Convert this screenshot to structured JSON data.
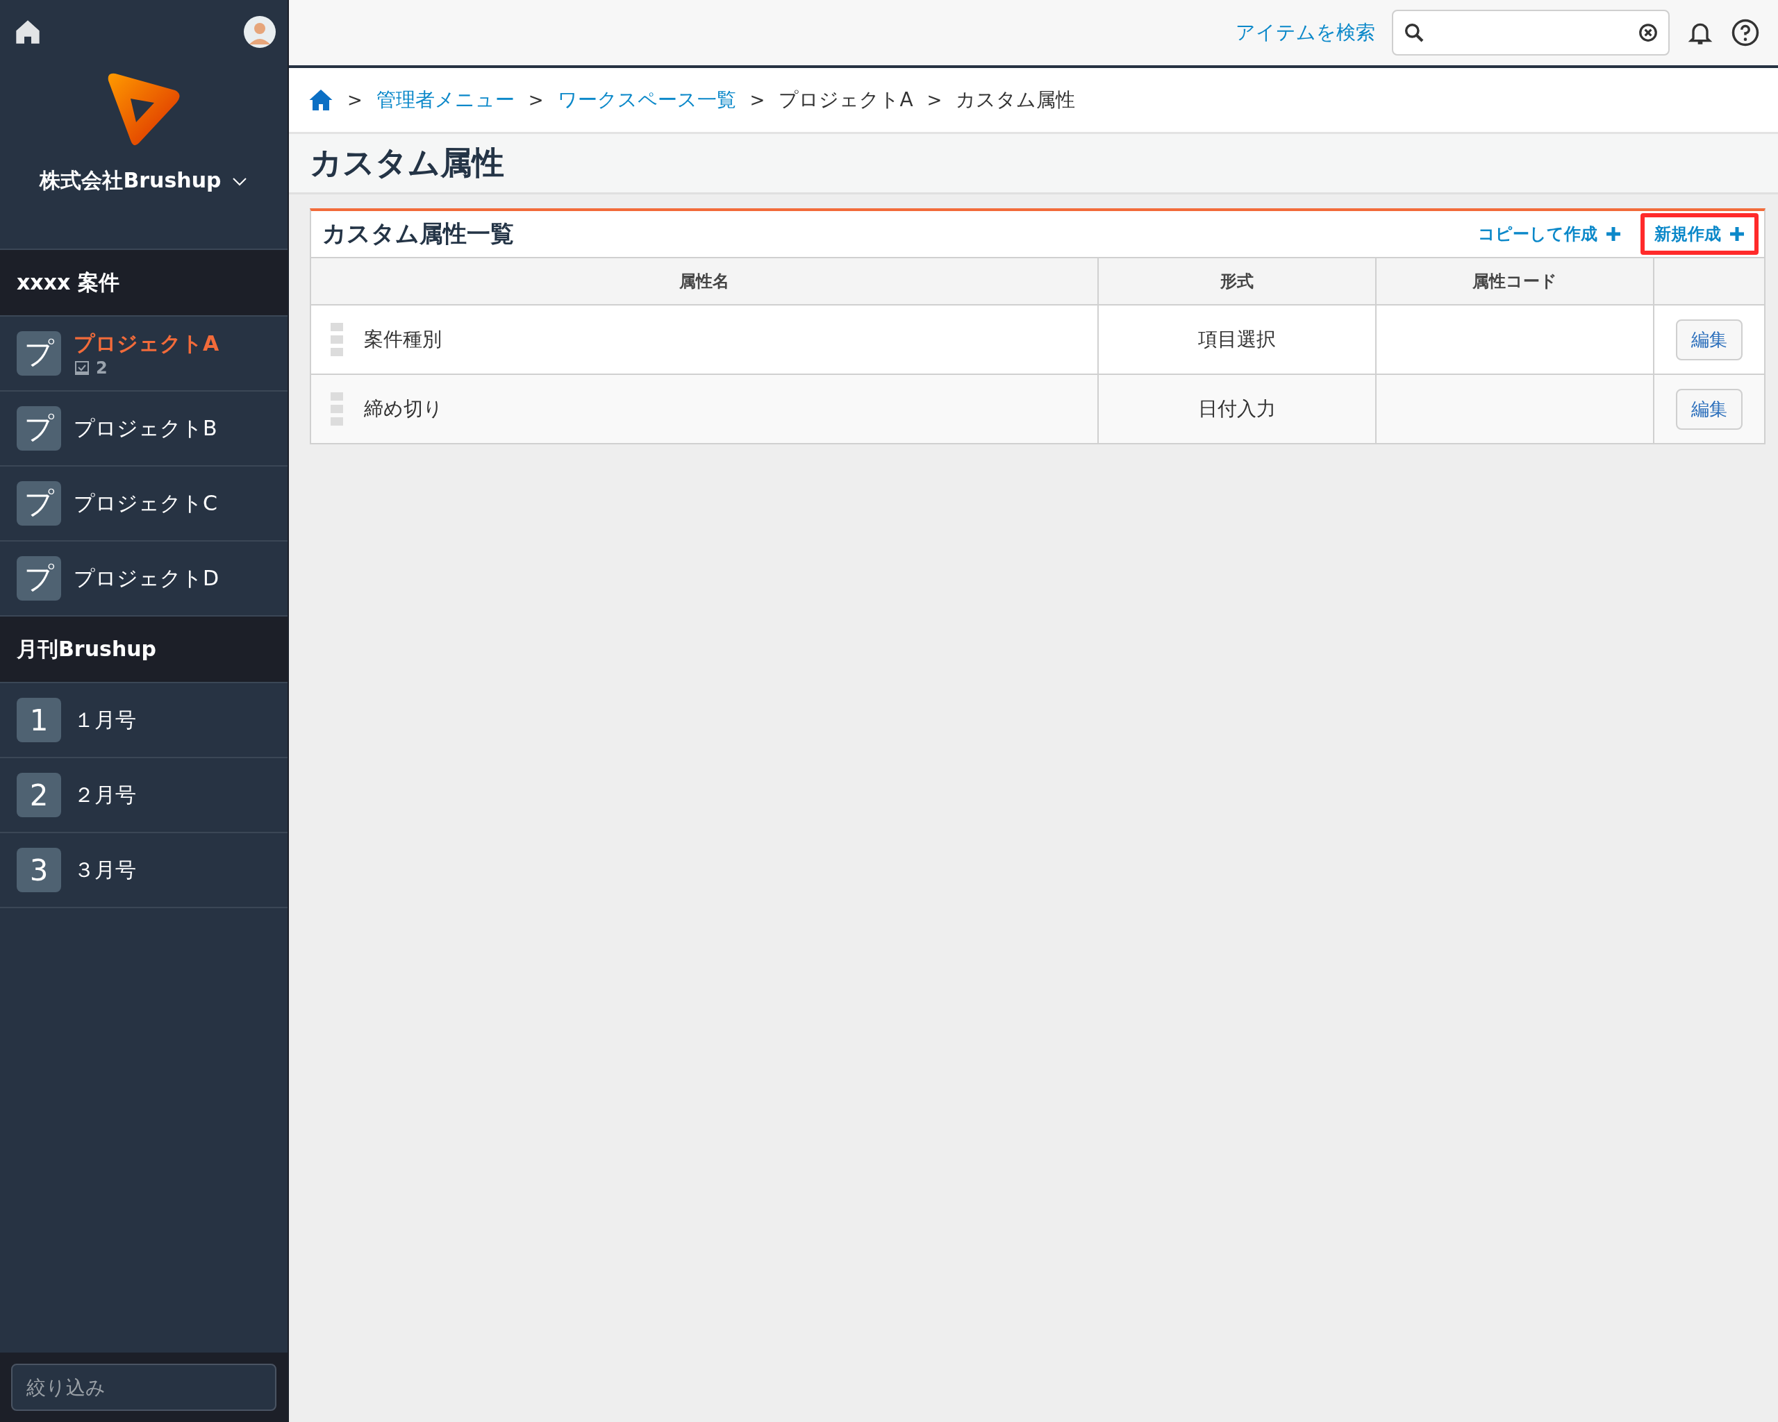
{
  "sidebar": {
    "company": "株式会社Brushup",
    "groups": [
      {
        "title": "xxxx 案件",
        "items": [
          {
            "icon_char": "プ",
            "label": "プロジェクトA",
            "selected": true,
            "task_count": "2"
          },
          {
            "icon_char": "プ",
            "label": "プロジェクトB",
            "selected": false
          },
          {
            "icon_char": "プ",
            "label": "プロジェクトC",
            "selected": false
          },
          {
            "icon_char": "プ",
            "label": "プロジェクトD",
            "selected": false
          }
        ]
      },
      {
        "title": "月刊Brushup",
        "items": [
          {
            "icon_char": "1",
            "label": "１月号",
            "selected": false
          },
          {
            "icon_char": "2",
            "label": "２月号",
            "selected": false
          },
          {
            "icon_char": "3",
            "label": "３月号",
            "selected": false
          }
        ]
      }
    ],
    "filter": {
      "placeholder": "絞り込み"
    }
  },
  "topbar": {
    "search_link": "アイテムを検索"
  },
  "breadcrumb": [
    {
      "separator": ">",
      "label": "管理者メニュー",
      "link": true
    },
    {
      "separator": ">",
      "label": "ワークスペース一覧",
      "link": true
    },
    {
      "separator": ">",
      "label": "プロジェクトA",
      "link": false
    },
    {
      "separator": ">",
      "label": "カスタム属性",
      "link": false
    }
  ],
  "page_title": "カスタム属性",
  "panel": {
    "title": "カスタム属性一覧",
    "actions": [
      {
        "label": "コピーして作成",
        "highlighted": false
      },
      {
        "label": "新規作成",
        "highlighted": true
      }
    ],
    "columns": [
      "属性名",
      "形式",
      "属性コード"
    ],
    "rows": [
      {
        "name": "案件種別",
        "format": "項目選択",
        "edit": "編集"
      },
      {
        "name": "締め切り",
        "format": "日付入力",
        "edit": "編集"
      }
    ]
  }
}
